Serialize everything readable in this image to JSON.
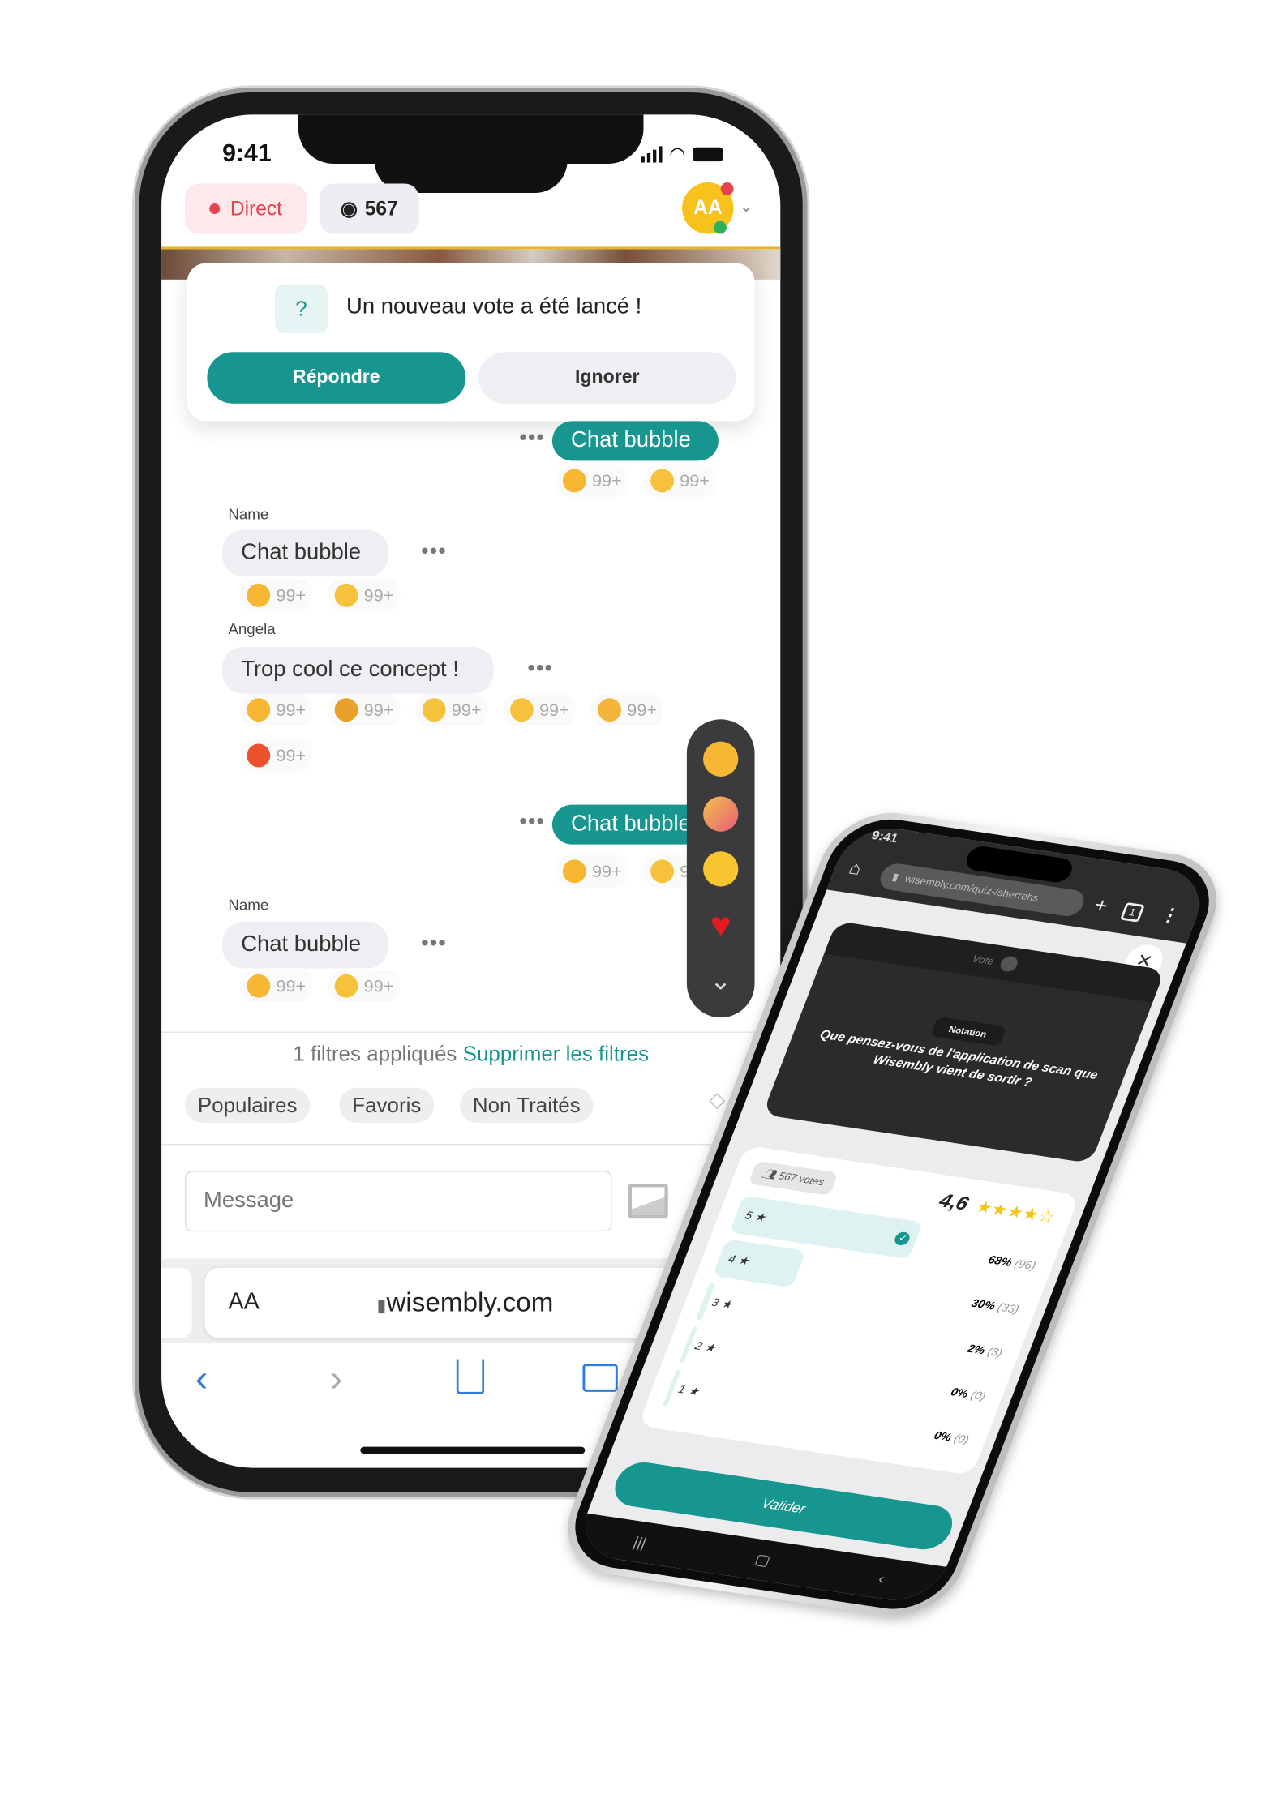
{
  "left_phone": {
    "status": {
      "time": "9:41"
    },
    "header": {
      "live_label": "Direct",
      "viewers": "567",
      "avatar_initials": "AA"
    },
    "notification": {
      "text": "Un nouveau vote a été lancé !",
      "primary": "Répondre",
      "secondary": "Ignorer"
    },
    "messages": [
      {
        "author": "",
        "text": "Chat bubble",
        "mine": true,
        "reactions": [
          {
            "icon": "thumbs-up",
            "count": "99+"
          },
          {
            "icon": "thinking-face",
            "count": "99+"
          }
        ]
      },
      {
        "author": "Name",
        "text": "Chat bubble",
        "mine": false,
        "reactions": [
          {
            "icon": "thumbs-up",
            "count": "99+"
          },
          {
            "icon": "thinking-face",
            "count": "99+"
          }
        ]
      },
      {
        "author": "Angela",
        "text": "Trop cool ce concept !",
        "mine": false,
        "reactions": [
          {
            "icon": "thumbs-up",
            "count": "99+"
          },
          {
            "icon": "thumbs-down",
            "count": "99+"
          },
          {
            "icon": "grimacing-face",
            "count": "99+"
          },
          {
            "icon": "thinking-face",
            "count": "99+"
          },
          {
            "icon": "surprised-face",
            "count": "99+"
          },
          {
            "icon": "angry-face",
            "count": "99+"
          }
        ]
      },
      {
        "author": "",
        "text": "Chat bubble",
        "mine": true,
        "reactions": [
          {
            "icon": "thumbs-up",
            "count": "99+"
          },
          {
            "icon": "thinking-face",
            "count": "99+"
          }
        ]
      },
      {
        "author": "Name",
        "text": "Chat bubble",
        "mine": false,
        "reactions": [
          {
            "icon": "thumbs-up",
            "count": "99+"
          },
          {
            "icon": "thinking-face",
            "count": "99+"
          }
        ]
      }
    ],
    "reaction_picker": [
      "thumbs-up",
      "party-popper",
      "tears-of-joy",
      "red-heart",
      "chevron-down"
    ],
    "filters": {
      "applied": "1 filtres appliqués",
      "clear": "Supprimer les filtres",
      "chips": [
        "Populaires",
        "Favoris",
        "Non Traités"
      ]
    },
    "composer": {
      "placeholder": "Message"
    },
    "browser": {
      "text_size": "AA",
      "url": "wisembly.com"
    }
  },
  "right_phone": {
    "status": {
      "time": "9:41"
    },
    "browser": {
      "url": "wisembly.com/quiz-/sherrehs",
      "tabs": "1"
    },
    "card": {
      "type_label": "Vote",
      "tag": "Notation",
      "question": "Que pensez-vous de l'application de scan que Wisembly vient de sortir ?"
    },
    "results": {
      "votes": "567 votes",
      "average": "4,6",
      "stars_filled": 4,
      "rows": [
        {
          "label": "5",
          "percent": "68%",
          "count": "(96)",
          "fill": 68,
          "selected": true
        },
        {
          "label": "4",
          "percent": "30%",
          "count": "(33)",
          "fill": 30,
          "selected": false
        },
        {
          "label": "3",
          "percent": "2%",
          "count": "(3)",
          "fill": 2,
          "selected": false
        },
        {
          "label": "2",
          "percent": "0%",
          "count": "(0)",
          "fill": 0,
          "selected": false
        },
        {
          "label": "1",
          "percent": "0%",
          "count": "(0)",
          "fill": 0,
          "selected": false
        }
      ]
    },
    "submit": "Valider"
  },
  "colors": {
    "accent": "#17958f",
    "live": "#e5434f",
    "star": "#f5c518"
  }
}
